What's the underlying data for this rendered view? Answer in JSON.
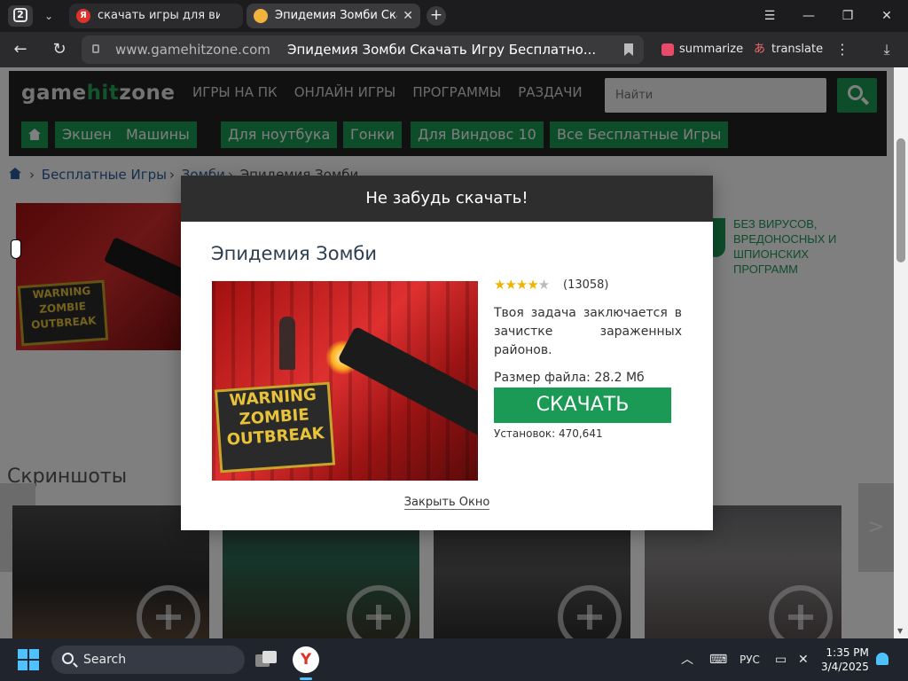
{
  "browser": {
    "tab_count": "2",
    "tabs": [
      {
        "title": "скачать игры для виндов"
      },
      {
        "title": "Эпидемия Зомби Скача"
      }
    ],
    "address": {
      "domain": "www.gamehitzone.com",
      "page_title": "Эпидемия Зомби Скачать Игру Бесплатно..."
    },
    "extensions": {
      "summarize": "summarize",
      "translate": "translate"
    }
  },
  "site": {
    "logo": {
      "part1": "game",
      "part2": "hit",
      "part3": "zone"
    },
    "topnav": [
      "ИГРЫ НА ПК",
      "ОНЛАЙН ИГРЫ",
      "ПРОГРАММЫ",
      "РАЗДАЧИ"
    ],
    "search_placeholder": "Найти",
    "categories": [
      "Экшен",
      "Машины",
      "Для ноутбука",
      "Гонки",
      "Для Виндовс 10",
      "Все Бесплатные Игры"
    ],
    "breadcrumb": {
      "item1": "Бесплатные Игры",
      "item2": "Зомби",
      "current": "Эпидемия Зомби"
    },
    "trust_text": "БЕЗ ВИРУСОВ, ВРЕДОНОСНЫХ И ШПИОНСКИХ ПРОГРАММ",
    "screenshots_heading": "Скриншоты"
  },
  "modal": {
    "header": "Не забудь скачать!",
    "game_title": "Эпидемия Зомби",
    "image_sign": {
      "line1": "WARNING",
      "line2": "ZOMBIE",
      "line3": "OUTBREAK"
    },
    "rating_stars": 4,
    "rating_count": "(13058)",
    "description": "Твоя задача заключается в зачистке зараженных районов.",
    "file_size": "Размер файла: 28.2 Мб",
    "download_label": "СКАЧАТЬ",
    "installs": "Установок: 470,641",
    "close_label": "Закрыть Окно"
  },
  "taskbar": {
    "search_label": "Search",
    "language": "РУС",
    "time": "1:35 PM",
    "date": "3/4/2025"
  }
}
